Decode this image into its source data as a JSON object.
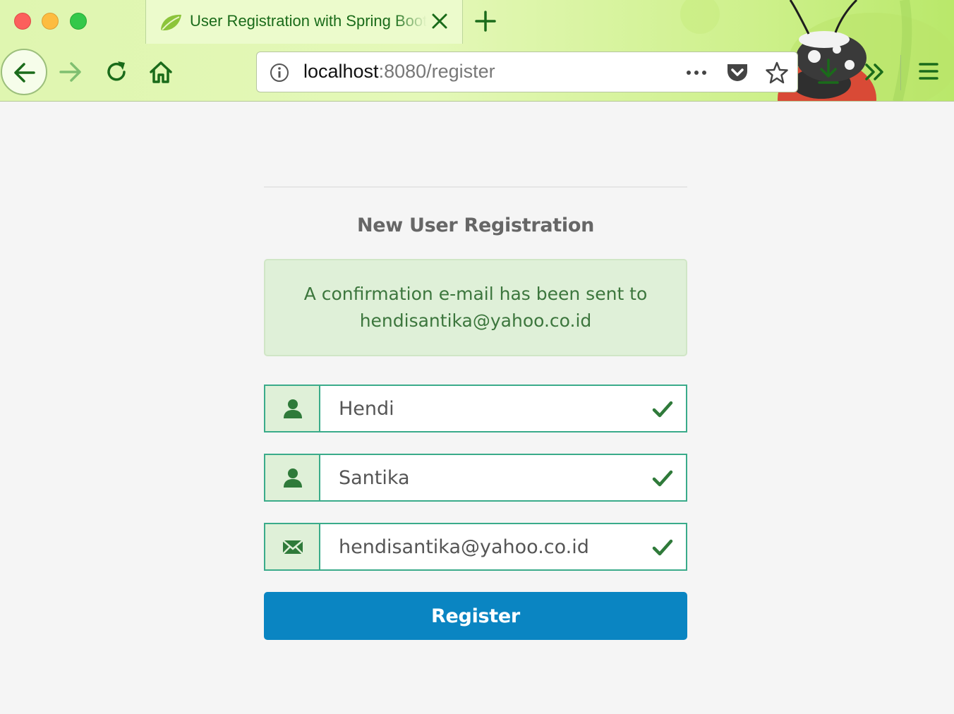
{
  "browser": {
    "tab_title": "User Registration with Spring Boot",
    "url_host": "localhost",
    "url_rest": ":8080/register"
  },
  "page": {
    "title": "New User Registration",
    "alert_line1": "A confirmation e-mail has been sent to",
    "alert_line2": "hendisantika@yahoo.co.id"
  },
  "form": {
    "first_name": "Hendi",
    "last_name": "Santika",
    "email": "hendisantika@yahoo.co.id",
    "submit_label": "Register"
  },
  "colors": {
    "success_bg": "#dff0d8",
    "success_text": "#3c763d",
    "field_border": "#3aab8a",
    "button_blue": "#0a85c2",
    "chrome_green": "#1a6b1a"
  },
  "icons": [
    "spring-leaf-icon",
    "close-icon",
    "plus-icon",
    "back-arrow-icon",
    "forward-arrow-icon",
    "reload-icon",
    "home-icon",
    "info-icon",
    "more-dots-icon",
    "pocket-icon",
    "star-icon",
    "download-icon",
    "overflow-chevrons-icon",
    "hamburger-menu-icon",
    "user-icon",
    "envelope-icon",
    "checkmark-icon"
  ]
}
